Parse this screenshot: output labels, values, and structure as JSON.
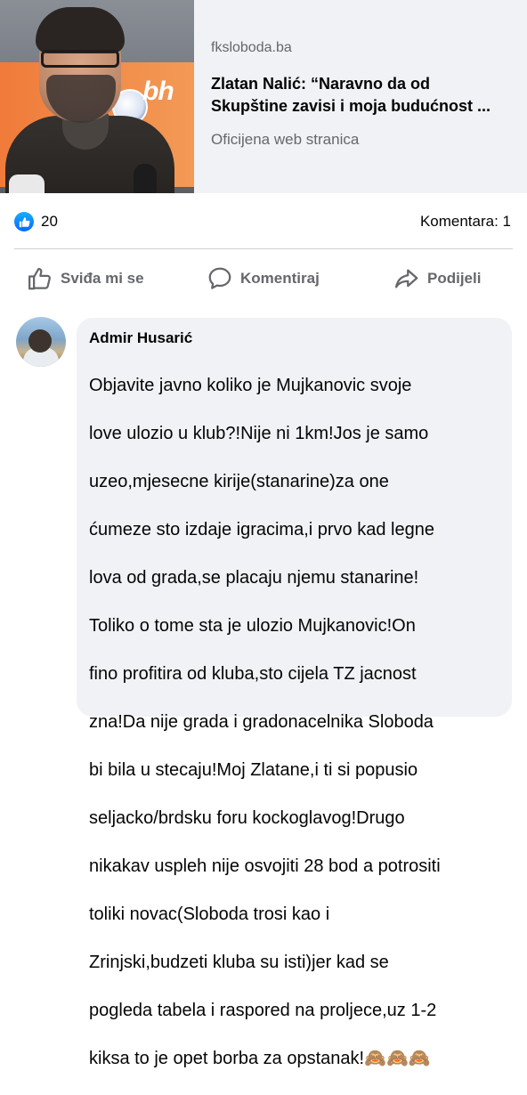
{
  "link_preview": {
    "domain": "fksloboda.ba",
    "headline": "Zlatan Nalić: “Naravno da od Skupštine zavisi i moja budućnost ...",
    "source": "Oficijena web stranica",
    "thumbnail_text": "bh"
  },
  "reactions": {
    "like_count": "20",
    "comments_label": "Komentara: 1"
  },
  "actions": {
    "like_label": "Sviđa mi se",
    "comment_label": "Komentiraj",
    "share_label": "Podijeli"
  },
  "comment": {
    "author": "Admir Husarić",
    "text_lines": [
      "Objavite javno koliko je Mujkanovic svoje",
      "love ulozio u klub?!Nije ni 1km!Jos je samo",
      "uzeo,mjesecne kirije(stanarine)za one",
      "ćumeze sto izdaje igracima,i prvo kad legne",
      "lova od grada,se placaju njemu stanarine!",
      "Toliko o tome sta je ulozio Mujkanovic!On",
      "fino profitira od kluba,sto cijela TZ jacnost",
      "zna!Da nije grada i gradonacelnika Sloboda",
      "bi bila u stecaju!Moj Zlatane,i ti si popusio",
      "seljacko/brdsku foru kockoglavog!Drugo",
      "nikakav uspleh nije osvojiti 28 bod a potrositi",
      "toliki novac(Sloboda trosi kao i",
      "Zrinjski,budzeti kluba su isti)jer kad se",
      "pogleda tabela i raspored na proljece,uz 1-2",
      "kiksa to je opet borba za opstanak!🙈🙈🙈"
    ]
  },
  "icons": {
    "like_badge": "thumbs-up-icon",
    "like_action": "thumbs-up-outline-icon",
    "comment_action": "speech-bubble-icon",
    "share_action": "share-arrow-icon"
  },
  "colors": {
    "facebook_blue": "#0866ff",
    "secondary_text": "#65676b",
    "card_background": "#f0f2f5"
  }
}
